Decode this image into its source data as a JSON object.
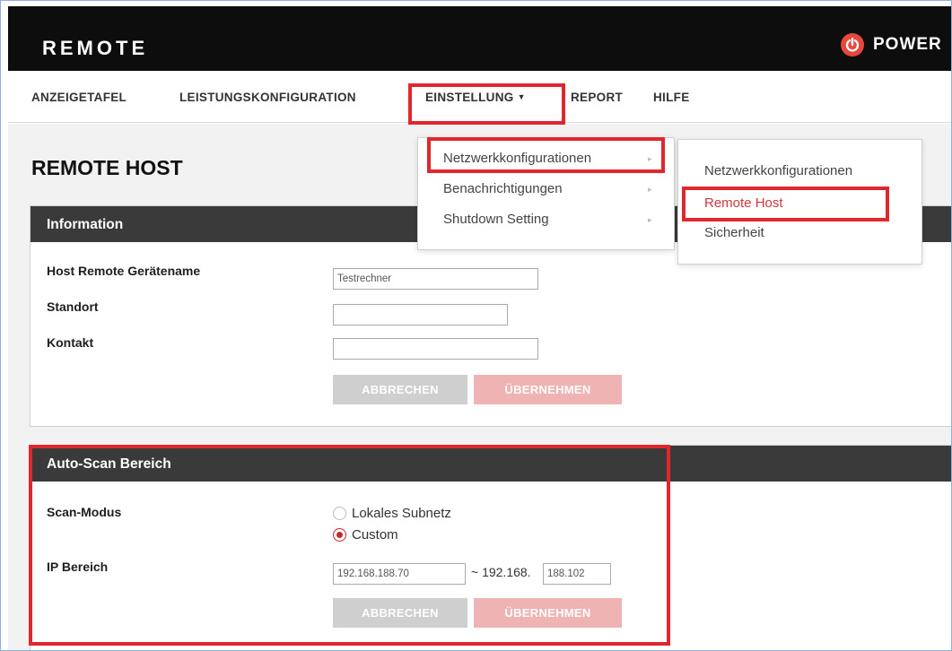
{
  "header": {
    "brand": "REMOTE",
    "logo_text": "POWER",
    "logo_icon": "power-icon"
  },
  "nav": {
    "items": [
      {
        "label": "ANZEIGETAFEL"
      },
      {
        "label": "LEISTUNGSKONFIGURATION"
      },
      {
        "label": "EINSTELLUNG"
      },
      {
        "label": "REPORT"
      },
      {
        "label": "HILFE"
      }
    ],
    "dropdown_caret": "▼"
  },
  "dropdown": {
    "items": [
      {
        "label": "Netzwerkkonfigurationen"
      },
      {
        "label": "Benachrichtigungen"
      },
      {
        "label": "Shutdown Setting"
      }
    ],
    "arrow": "▸"
  },
  "submenu": {
    "items": [
      {
        "label": "Netzwerkkonfigurationen"
      },
      {
        "label": "Remote Host"
      },
      {
        "label": "Sicherheit"
      }
    ]
  },
  "page": {
    "title": "REMOTE HOST"
  },
  "info_panel": {
    "title": "Information",
    "fields": {
      "device_name_label": "Host Remote Gerätename",
      "device_name_value": "Testrechner",
      "location_label": "Standort",
      "location_value": "",
      "contact_label": "Kontakt",
      "contact_value": ""
    },
    "cancel_label": "ABBRECHEN",
    "apply_label": "ÜBERNEHMEN"
  },
  "scan_panel": {
    "title": "Auto-Scan Bereich",
    "mode_label": "Scan-Modus",
    "mode_options": [
      {
        "label": "Lokales Subnetz",
        "selected": false
      },
      {
        "label": "Custom",
        "selected": true
      }
    ],
    "ip_label": "IP Bereich",
    "ip_start": "192.168.188.70",
    "ip_separator": "~ 192.168.",
    "ip_end": "188.102",
    "cancel_label": "ABBRECHEN",
    "apply_label": "ÜBERNEHMEN"
  },
  "colors": {
    "highlight": "#e1262e",
    "accent": "#d2363f",
    "header_bg": "#0d0d0d",
    "panel_header_bg": "#3a3a3a"
  }
}
